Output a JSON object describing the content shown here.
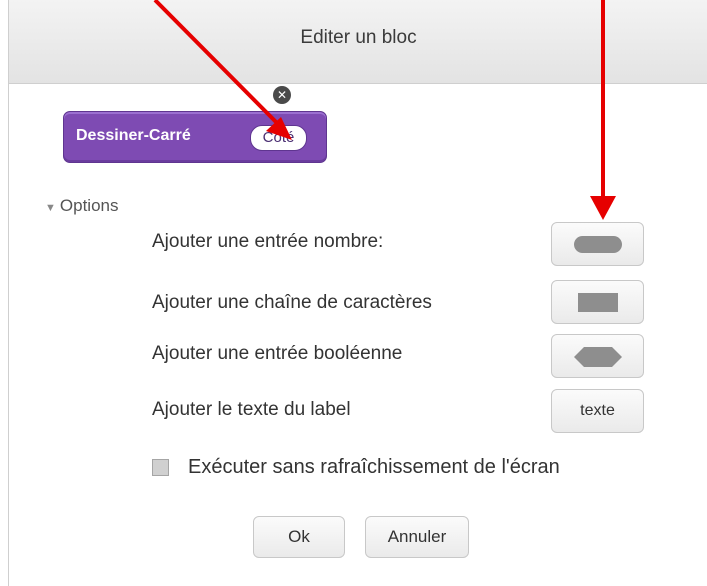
{
  "dialog": {
    "title": "Editer un bloc",
    "block": {
      "name": "Dessiner-Carré",
      "param": "Coté"
    },
    "options_label": "Options",
    "rows": [
      {
        "label": "Ajouter une entrée nombre:",
        "button": "number-input"
      },
      {
        "label": "Ajouter une chaîne de caractères",
        "button": "string-input"
      },
      {
        "label": "Ajouter une entrée booléenne",
        "button": "boolean-input"
      },
      {
        "label": "Ajouter le texte du label",
        "button_text": "texte"
      }
    ],
    "checkbox_label": "Exécuter sans rafraîchissement de l'écran",
    "ok_label": "Ok",
    "cancel_label": "Annuler"
  },
  "colors": {
    "block_purple": "#7e4bb3",
    "arrow_red": "#e60000"
  }
}
